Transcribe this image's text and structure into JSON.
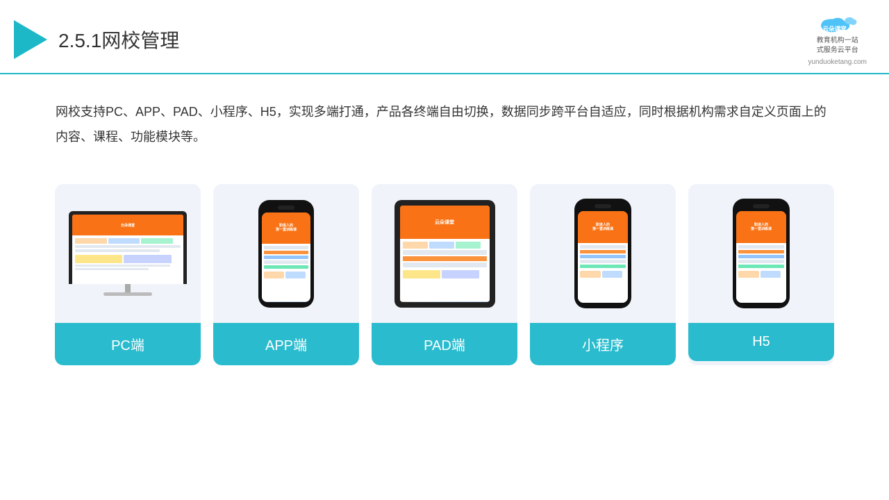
{
  "header": {
    "title": "2.5.1",
    "title_cn": "网校管理",
    "brand_name": "云朵课堂",
    "brand_url": "yunduoketang.com",
    "brand_tagline": "教育机构一站\n式服务云平台"
  },
  "description": "网校支持PC、APP、PAD、小程序、H5，实现多端打通，产品各终端自由切换，数据同步跨平台自适应，同时根据机构需求自定义页面上的内容、课程、功能模块等。",
  "cards": [
    {
      "id": "pc",
      "label": "PC端"
    },
    {
      "id": "app",
      "label": "APP端"
    },
    {
      "id": "pad",
      "label": "PAD端"
    },
    {
      "id": "mini",
      "label": "小程序"
    },
    {
      "id": "h5",
      "label": "H5"
    }
  ]
}
